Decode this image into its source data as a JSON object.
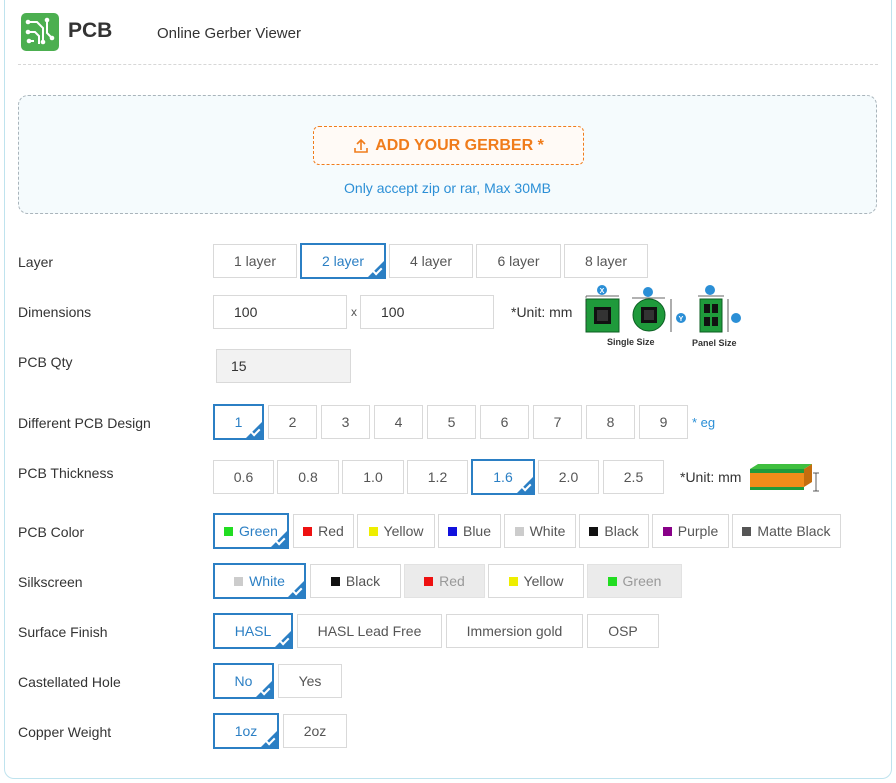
{
  "header": {
    "brand": "PCB",
    "subtitle": "Online Gerber Viewer",
    "logo_icon": "circuit-board-icon",
    "logo_color": "#4caf50"
  },
  "upload": {
    "button_label": "ADD YOUR GERBER *",
    "button_icon": "upload-icon",
    "note": "Only accept zip or rar, Max 30MB",
    "accent_color": "#f07c1b"
  },
  "layer": {
    "label": "Layer",
    "options": [
      "1 layer",
      "2 layer",
      "4 layer",
      "6 layer",
      "8 layer"
    ],
    "selected": "2 layer"
  },
  "dimensions": {
    "label": "Dimensions",
    "x_value": "100",
    "separator": "x",
    "y_value": "100",
    "unit": "*Unit: mm",
    "single_caption": "Single Size",
    "panel_caption": "Panel Size",
    "axis_x": "X",
    "axis_y": "Y"
  },
  "qty": {
    "label": "PCB Qty",
    "value": "15"
  },
  "design": {
    "label": "Different PCB Design",
    "options": [
      "1",
      "2",
      "3",
      "4",
      "5",
      "6",
      "7",
      "8",
      "9"
    ],
    "selected": "1",
    "eg_link": "* eg"
  },
  "thickness": {
    "label": "PCB Thickness",
    "options": [
      "0.6",
      "0.8",
      "1.0",
      "1.2",
      "1.6",
      "2.0",
      "2.5"
    ],
    "selected": "1.6",
    "unit": "*Unit: mm"
  },
  "color": {
    "label": "PCB Color",
    "options": [
      {
        "label": "Green",
        "swatch": "#22dd22"
      },
      {
        "label": "Red",
        "swatch": "#ee1111"
      },
      {
        "label": "Yellow",
        "swatch": "#eeee00"
      },
      {
        "label": "Blue",
        "swatch": "#1111dd"
      },
      {
        "label": "White",
        "swatch": "#cccccc"
      },
      {
        "label": "Black",
        "swatch": "#111111"
      },
      {
        "label": "Purple",
        "swatch": "#880088"
      },
      {
        "label": "Matte Black",
        "swatch": "#555555"
      }
    ],
    "selected": "Green"
  },
  "silkscreen": {
    "label": "Silkscreen",
    "options": [
      {
        "label": "White",
        "swatch": "#cccccc",
        "disabled": false
      },
      {
        "label": "Black",
        "swatch": "#111111",
        "disabled": false
      },
      {
        "label": "Red",
        "swatch": "#ee1111",
        "disabled": true
      },
      {
        "label": "Yellow",
        "swatch": "#eeee00",
        "disabled": false
      },
      {
        "label": "Green",
        "swatch": "#22dd22",
        "disabled": true
      }
    ],
    "selected": "White"
  },
  "finish": {
    "label": "Surface Finish",
    "options": [
      "HASL",
      "HASL Lead Free",
      "Immersion gold",
      "OSP"
    ],
    "selected": "HASL"
  },
  "castellated": {
    "label": "Castellated Hole",
    "options": [
      "No",
      "Yes"
    ],
    "selected": "No"
  },
  "copper": {
    "label": "Copper Weight",
    "options": [
      "1oz",
      "2oz"
    ],
    "selected": "1oz"
  },
  "colors": {
    "selected_blue": "#2b7fc4",
    "link_blue": "#2b8fd6",
    "frame_border": "#bfe3ee"
  }
}
